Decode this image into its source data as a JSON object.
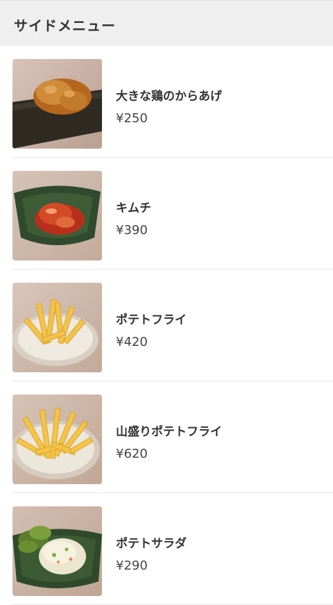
{
  "header": {
    "title": "サイドメニュー"
  },
  "items": [
    {
      "name": "大きな鶏のからあげ",
      "price": "¥250",
      "image": "karaage-photo"
    },
    {
      "name": "キムチ",
      "price": "¥390",
      "image": "kimchi-photo"
    },
    {
      "name": "ポテトフライ",
      "price": "¥420",
      "image": "fries-photo"
    },
    {
      "name": "山盛りポテトフライ",
      "price": "¥620",
      "image": "large-fries-photo"
    },
    {
      "name": "ポテトサラダ",
      "price": "¥290",
      "image": "potato-salad-photo"
    }
  ]
}
